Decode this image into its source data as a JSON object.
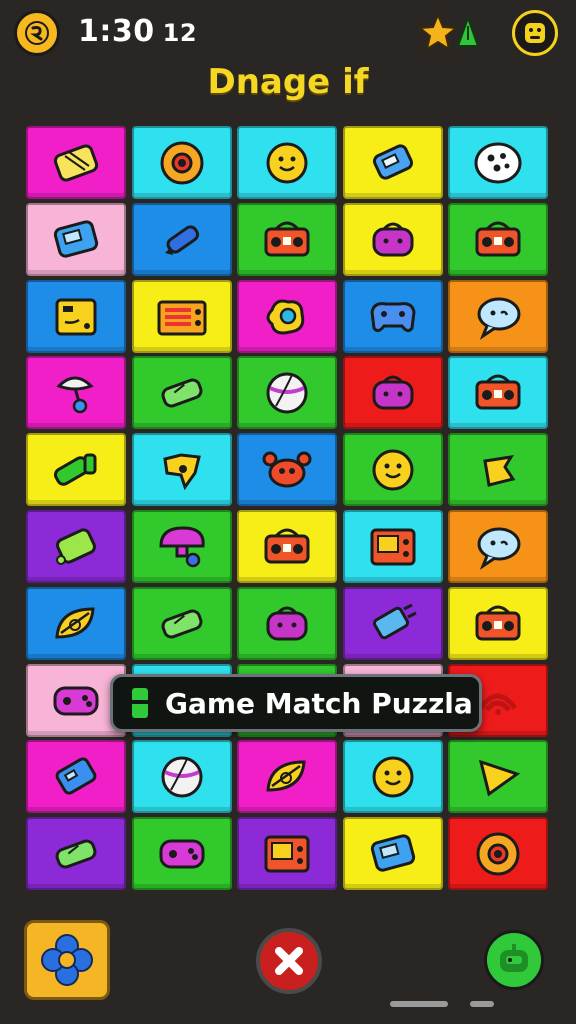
{
  "header": {
    "timer": "1:30",
    "timer_extra": "12",
    "title": "Dnage if"
  },
  "tooltip": {
    "text": "Game Match Puzzla"
  },
  "colors": {
    "magenta": "#f01fc8",
    "cyan": "#2fe0ef",
    "yellow": "#f7ee17",
    "green": "#31c92c",
    "blue": "#1e8de8",
    "pink": "#f8b4d6",
    "orange": "#f79218",
    "red": "#ee1b1b",
    "purple": "#8b2ad6"
  },
  "board": {
    "rows": [
      [
        {
          "bg": "magenta",
          "icon": "cassette-icon"
        },
        {
          "bg": "cyan",
          "icon": "donut-icon"
        },
        {
          "bg": "cyan",
          "icon": "smiley-icon"
        },
        {
          "bg": "yellow",
          "icon": "robot-icon"
        },
        {
          "bg": "cyan",
          "icon": "cookie-icon"
        }
      ],
      [
        {
          "bg": "pink",
          "icon": "handheld-icon"
        },
        {
          "bg": "blue",
          "icon": "marker-icon"
        },
        {
          "bg": "green",
          "icon": "radio-icon"
        },
        {
          "bg": "yellow",
          "icon": "bag-icon"
        },
        {
          "bg": "green",
          "icon": "radio-icon"
        }
      ],
      [
        {
          "bg": "blue",
          "icon": "device-icon"
        },
        {
          "bg": "yellow",
          "icon": "console-icon"
        },
        {
          "bg": "magenta",
          "icon": "blob-icon"
        },
        {
          "bg": "blue",
          "icon": "controller-icon"
        },
        {
          "bg": "orange",
          "icon": "speech-bubble-icon"
        }
      ],
      [
        {
          "bg": "magenta",
          "icon": "pin-icon"
        },
        {
          "bg": "green",
          "icon": "battery-icon"
        },
        {
          "bg": "green",
          "icon": "ball-icon"
        },
        {
          "bg": "red",
          "icon": "bag-icon"
        },
        {
          "bg": "cyan",
          "icon": "radio-icon"
        }
      ],
      [
        {
          "bg": "yellow",
          "icon": "spray-icon"
        },
        {
          "bg": "cyan",
          "icon": "star-blob-icon"
        },
        {
          "bg": "blue",
          "icon": "crab-icon"
        },
        {
          "bg": "green",
          "icon": "smiley-icon"
        },
        {
          "bg": "green",
          "icon": "heart-icon"
        }
      ],
      [
        {
          "bg": "purple",
          "icon": "tag-icon"
        },
        {
          "bg": "green",
          "icon": "mushroom-icon"
        },
        {
          "bg": "yellow",
          "icon": "radio-icon"
        },
        {
          "bg": "cyan",
          "icon": "tv-icon"
        },
        {
          "bg": "orange",
          "icon": "speech-bubble-icon"
        }
      ],
      [
        {
          "bg": "blue",
          "icon": "leaf-icon"
        },
        {
          "bg": "green",
          "icon": "battery-icon"
        },
        {
          "bg": "green",
          "icon": "bag-icon"
        },
        {
          "bg": "purple",
          "icon": "plug-icon"
        },
        {
          "bg": "yellow",
          "icon": "radio-icon"
        }
      ],
      [
        {
          "bg": "pink",
          "icon": "gamepad-icon"
        },
        {
          "bg": "cyan",
          "icon": ""
        },
        {
          "bg": "green",
          "icon": ""
        },
        {
          "bg": "pink",
          "icon": ""
        },
        {
          "bg": "red",
          "icon": "wifi-icon"
        }
      ],
      [
        {
          "bg": "magenta",
          "icon": "walkie-icon"
        },
        {
          "bg": "cyan",
          "icon": "ball-icon"
        },
        {
          "bg": "magenta",
          "icon": "leaf-icon"
        },
        {
          "bg": "cyan",
          "icon": "smiley-icon"
        },
        {
          "bg": "green",
          "icon": "play-icon"
        }
      ],
      [
        {
          "bg": "purple",
          "icon": "battery-icon"
        },
        {
          "bg": "green",
          "icon": "gamepad-icon"
        },
        {
          "bg": "purple",
          "icon": "tv-icon"
        },
        {
          "bg": "yellow",
          "icon": "handheld-icon"
        },
        {
          "bg": "red",
          "icon": "donut-icon"
        }
      ]
    ]
  },
  "footer": {
    "left_icon": "flower-icon",
    "center_icon": "close-icon",
    "right_icon": "robot-icon"
  }
}
